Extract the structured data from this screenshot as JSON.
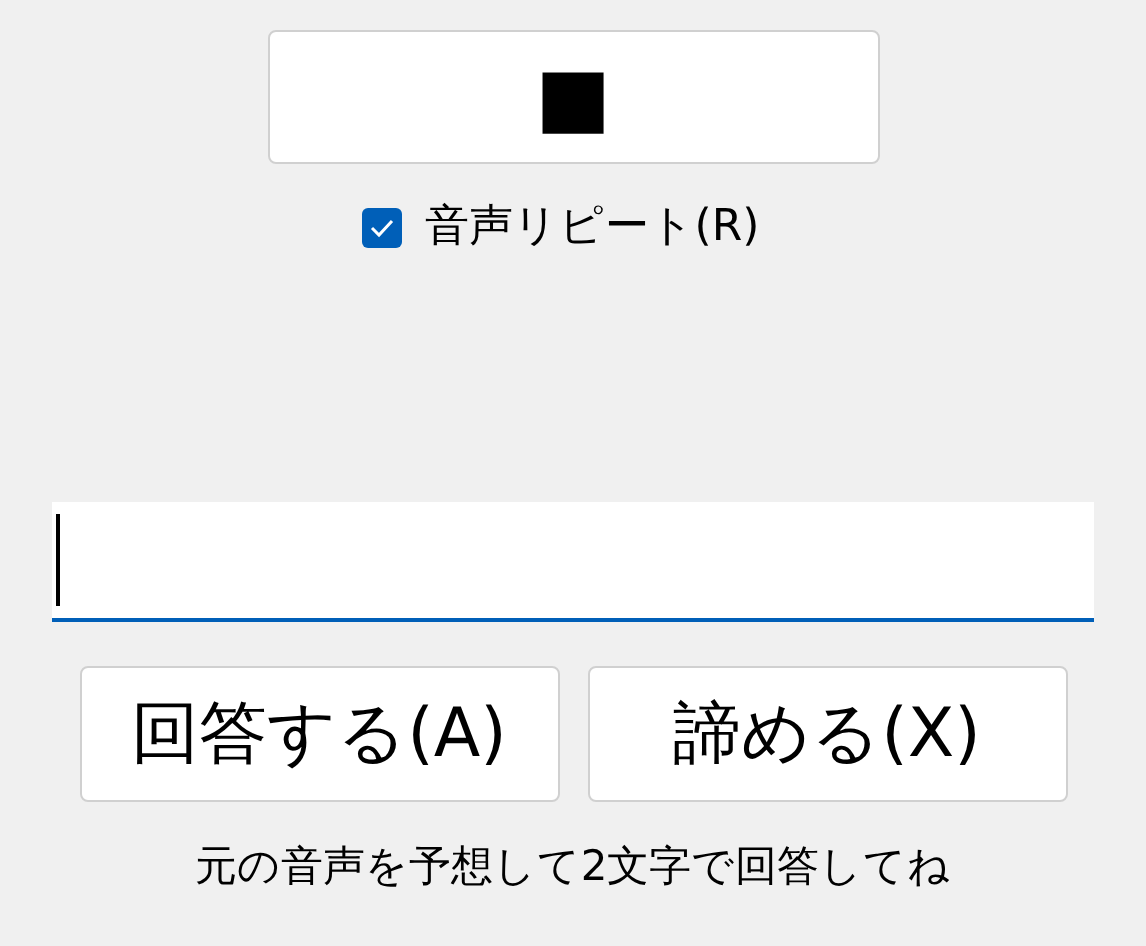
{
  "play_button": {
    "label": "■"
  },
  "repeat_checkbox": {
    "label": "音声リピート(R)",
    "checked": true
  },
  "answer_field": {
    "focused": true
  },
  "buttons": [
    {
      "label": "回答する(A)"
    },
    {
      "label": "諦める(X)"
    }
  ],
  "hint": "元の音声を予想して2文字で回答してね"
}
